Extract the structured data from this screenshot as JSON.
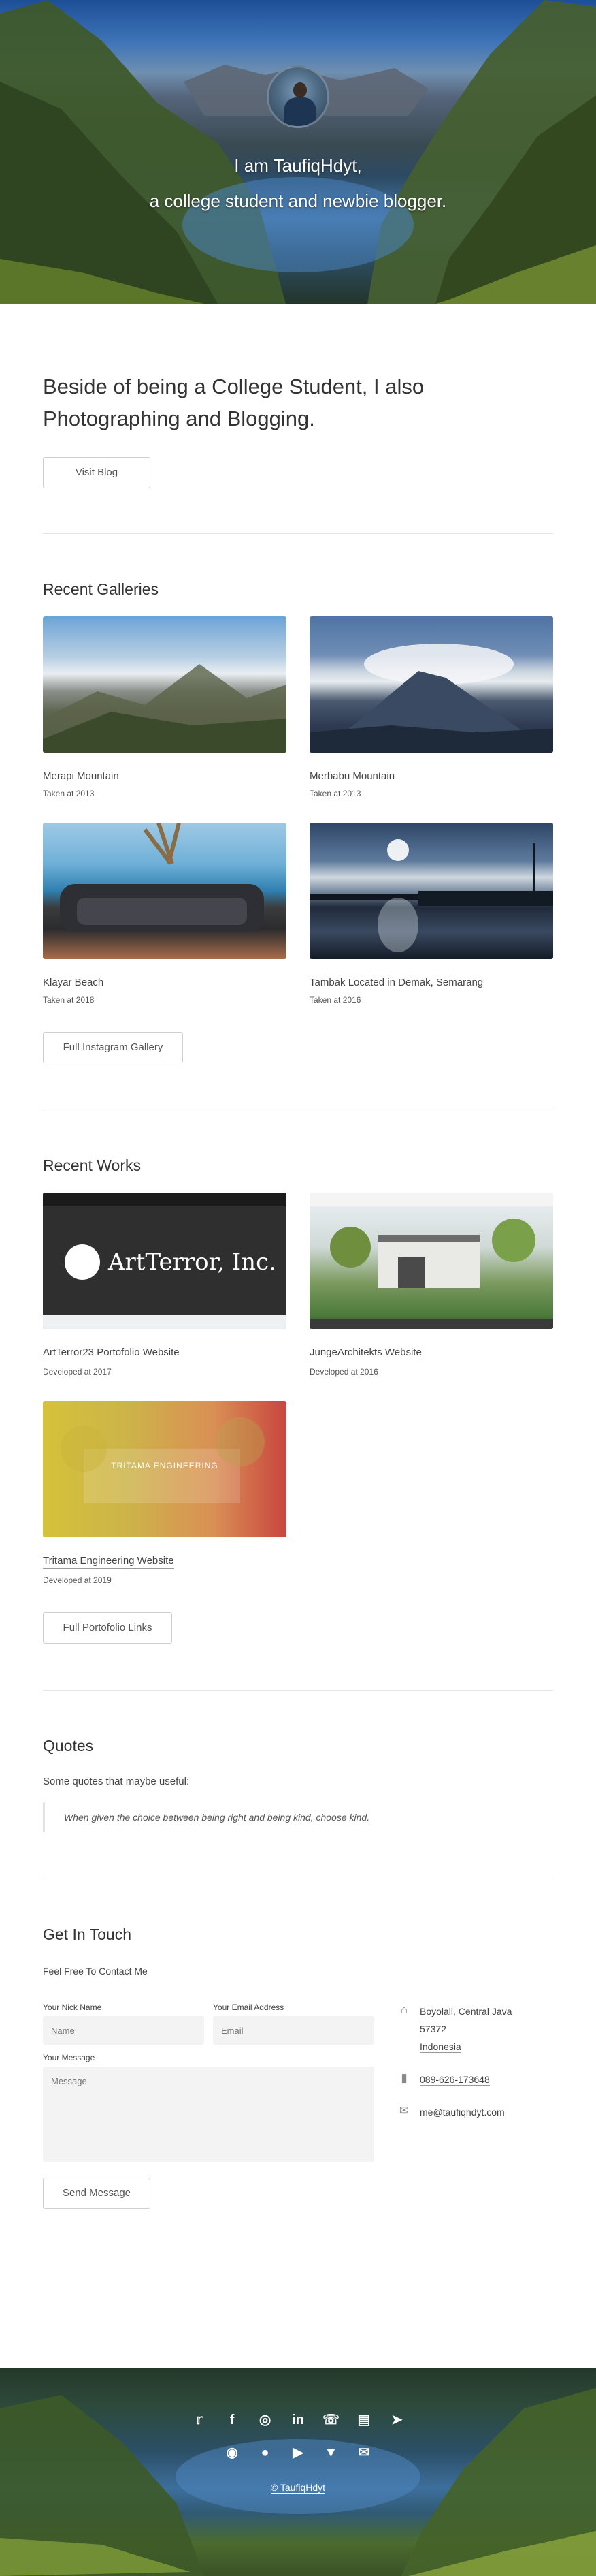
{
  "hero": {
    "title": "I am TaufiqHdyt,",
    "subtitle": "a college student and newbie blogger."
  },
  "intro": {
    "heading": "Beside of being a College Student, I also Photographing and Blogging.",
    "button": "Visit Blog"
  },
  "galleries": {
    "title": "Recent Galleries",
    "items": [
      {
        "title": "Merapi Mountain",
        "sub": "Taken at 2013"
      },
      {
        "title": "Merbabu Mountain",
        "sub": "Taken at 2013"
      },
      {
        "title": "Klayar Beach",
        "sub": "Taken at 2018"
      },
      {
        "title": "Tambak Located in Demak, Semarang",
        "sub": "Taken at 2016"
      }
    ],
    "button": "Full Instagram Gallery"
  },
  "works": {
    "title": "Recent Works",
    "items": [
      {
        "title": "ArtTerror23 Portofolio Website",
        "sub": "Developed at 2017",
        "thumb_text": "ArtTerror, Inc."
      },
      {
        "title": "JungeArchitekts Website",
        "sub": "Developed at 2016"
      },
      {
        "title": "Tritama Engineering Website",
        "sub": "Developed at 2019",
        "thumb_text": "TRITAMA ENGINEERING"
      }
    ],
    "button": "Full Portofolio Links"
  },
  "quotes": {
    "title": "Quotes",
    "lead": "Some quotes that maybe useful:",
    "quote": "When given the choice between being right and being kind, choose kind."
  },
  "contact": {
    "title": "Get In Touch",
    "lead": "Feel Free To Contact Me",
    "nick_label": "Your Nick Name",
    "nick_placeholder": "Name",
    "email_label": "Your Email Address",
    "email_placeholder": "Email",
    "message_label": "Your Message",
    "message_placeholder": "Message",
    "send_button": "Send Message",
    "address_line1": "Boyolali, Central Java",
    "address_line2": "57372",
    "address_line3": "Indonesia",
    "phone": "089-626-173648",
    "email": "me@taufiqhdyt.com"
  },
  "footer": {
    "copyright": "© TaufiqHdyt",
    "social_row1": [
      "twitter-icon",
      "facebook-icon",
      "instagram-icon",
      "linkedin-icon",
      "whatsapp-icon",
      "line-icon",
      "telegram-icon"
    ],
    "social_row2": [
      "discord-icon",
      "github-icon",
      "youtube-icon",
      "gitlab-icon",
      "mail-icon"
    ]
  }
}
